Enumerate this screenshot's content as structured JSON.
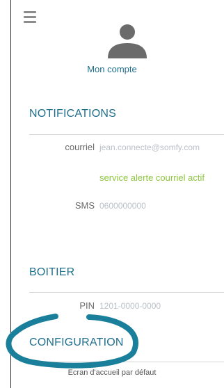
{
  "header": {
    "menu_icon": "hamburger-icon"
  },
  "account": {
    "icon": "user-icon",
    "label": "Mon compte"
  },
  "notifications": {
    "title": "NOTIFICATIONS",
    "email_label": "courriel",
    "email_value": "jean.connecte@somfy.com",
    "email_status": "service alerte courriel actif",
    "sms_label": "SMS",
    "sms_value": "0600000000"
  },
  "box": {
    "title": "BOITIER",
    "pin_label": "PIN",
    "pin_value": "1201-0000-0000"
  },
  "configuration": {
    "title": "CONFIGURATION",
    "home_screen_label": "Ecran d'accueil par défaut"
  },
  "colors": {
    "accent": "#1f6e8c",
    "status_green": "#8dc63f",
    "highlight_ring": "#1a7f9a"
  }
}
